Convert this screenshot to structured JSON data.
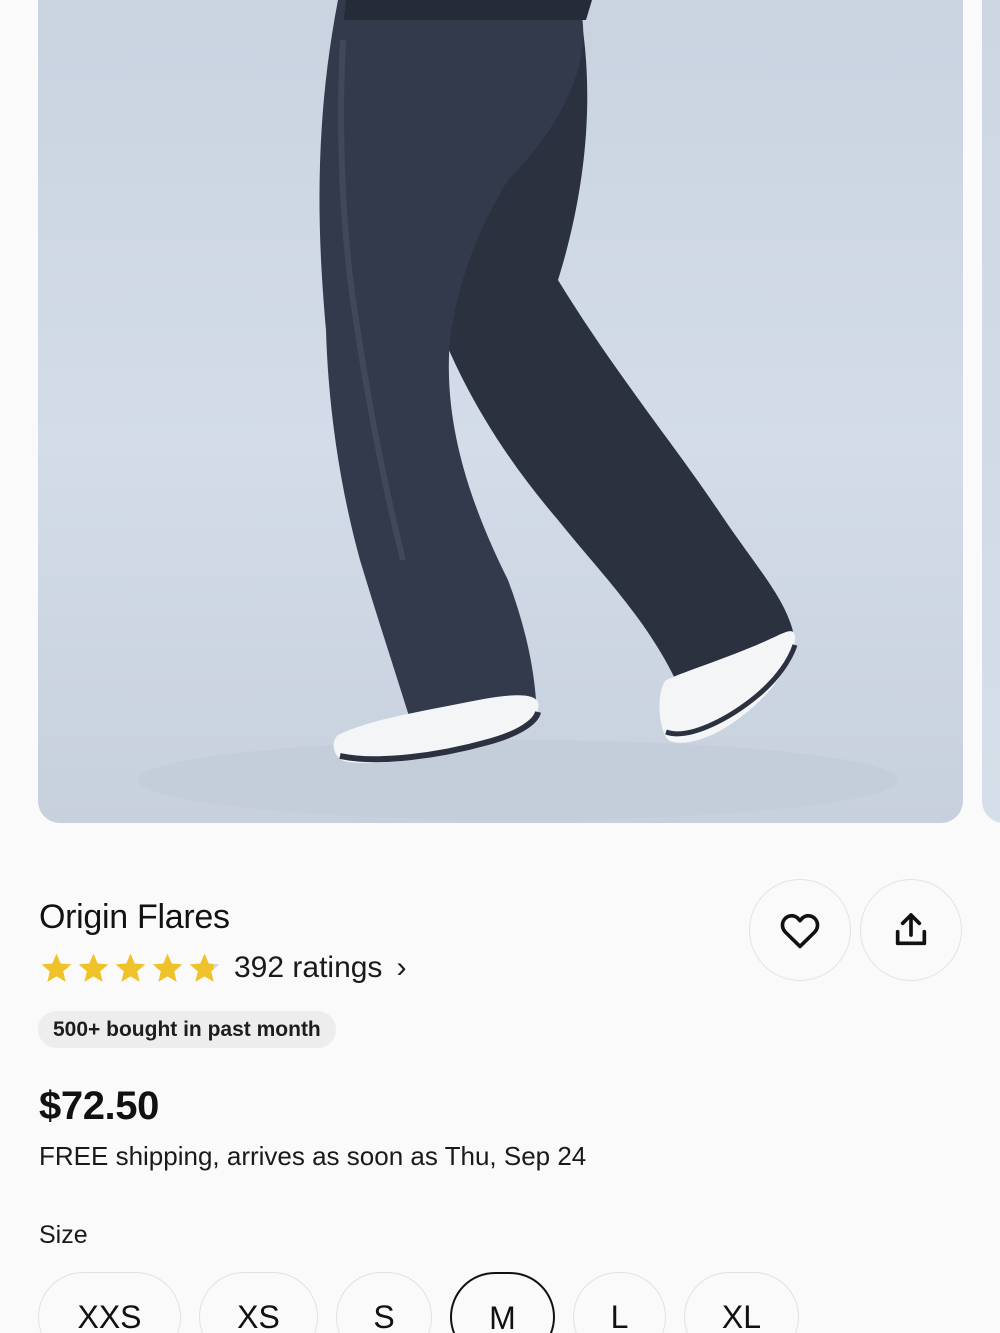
{
  "product": {
    "title": "Origin Flares",
    "rating_value": 4.8,
    "rating_max": 5,
    "ratings_text": "392 ratings",
    "badge": "500+ bought in past month",
    "price": "$72.50",
    "shipping": "FREE shipping, arrives as soon as Thu, Sep 24"
  },
  "actions": {
    "favorite_icon": "heart-icon",
    "share_icon": "share-icon"
  },
  "size": {
    "label": "Size",
    "options": [
      "XXS",
      "XS",
      "S",
      "M",
      "L",
      "XL"
    ],
    "selected": "M"
  },
  "colors": {
    "star": "#f0c229",
    "star_empty": "#d6d6d6",
    "pants": "#2c3140",
    "background": "#fafafa"
  }
}
